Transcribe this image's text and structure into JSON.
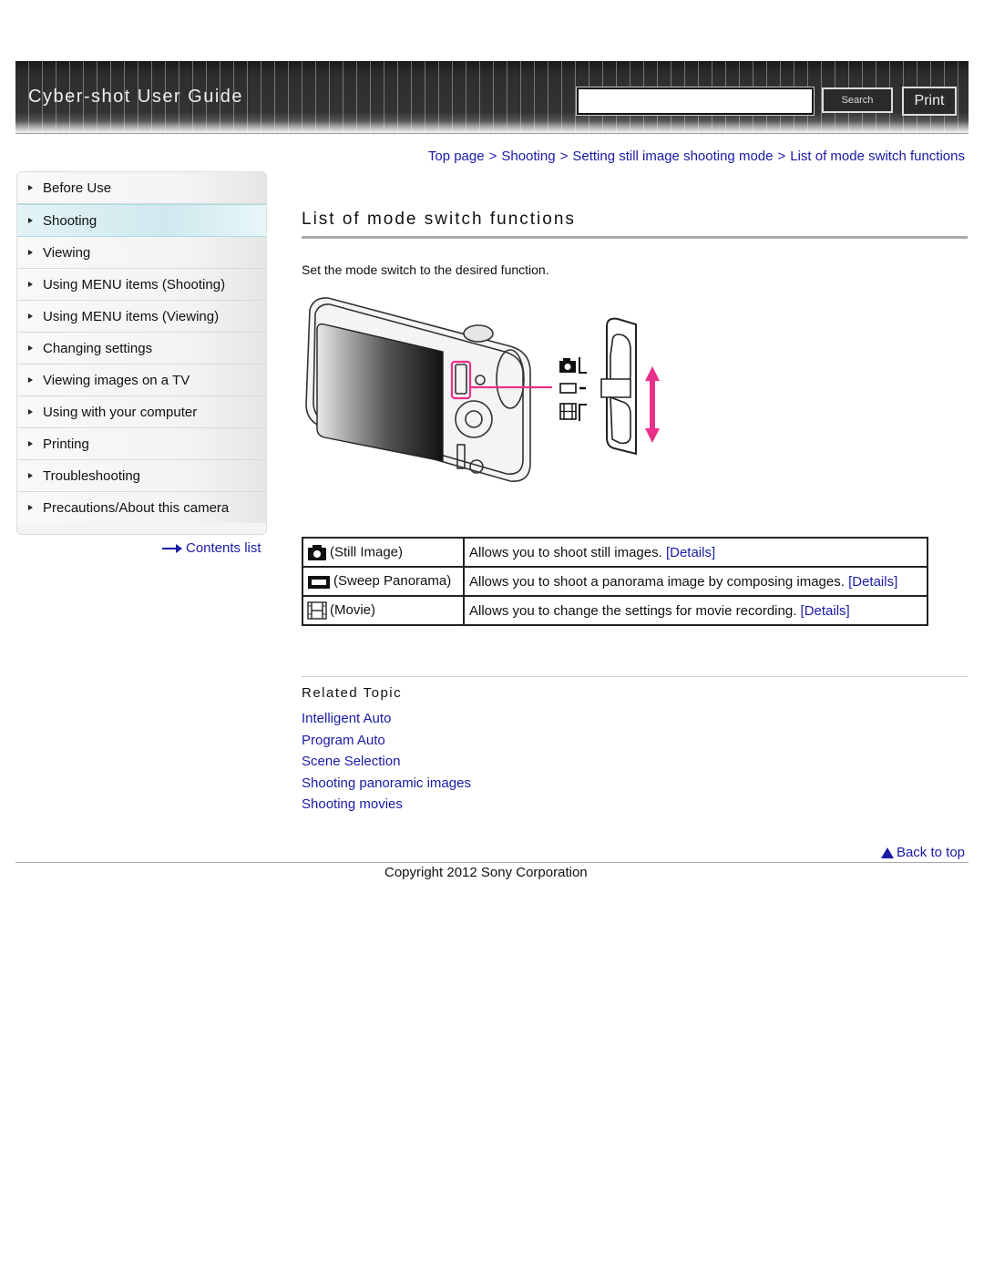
{
  "header": {
    "title": "Cyber-shot User Guide",
    "search_value": "",
    "search_button": "Search",
    "print_button": "Print"
  },
  "breadcrumb": [
    {
      "label": "Top page"
    },
    {
      "label": "Shooting"
    },
    {
      "label": "Setting still image shooting mode"
    },
    {
      "label": "List of mode switch functions"
    }
  ],
  "breadcrumb_separator": ">",
  "sidebar": {
    "items": [
      {
        "label": "Before Use",
        "active": false
      },
      {
        "label": "Shooting",
        "active": true
      },
      {
        "label": "Viewing",
        "active": false
      },
      {
        "label": "Using MENU items (Shooting)",
        "active": false
      },
      {
        "label": "Using MENU items (Viewing)",
        "active": false
      },
      {
        "label": "Changing settings",
        "active": false
      },
      {
        "label": "Viewing images on a TV",
        "active": false
      },
      {
        "label": "Using with your computer",
        "active": false
      },
      {
        "label": "Printing",
        "active": false
      },
      {
        "label": "Troubleshooting",
        "active": false
      },
      {
        "label": "Precautions/About this camera",
        "active": false
      }
    ],
    "contents_link": "Contents list"
  },
  "main": {
    "title": "List of mode switch functions",
    "intro": "Set the mode switch to the desired function.",
    "illustration_icons": [
      "still-image-icon",
      "sweep-panorama-icon",
      "movie-icon"
    ],
    "accent_color": "#e8308a",
    "modes": [
      {
        "icon": "still-image-icon",
        "name": "(Still Image)",
        "description": "Allows you to shoot still images.",
        "link": "[Details]"
      },
      {
        "icon": "sweep-panorama-icon",
        "name": "(Sweep Panorama)",
        "description": "Allows you to shoot a panorama image by composing images.",
        "link": "[Details]"
      },
      {
        "icon": "movie-icon",
        "name": "(Movie)",
        "description": "Allows you to change the settings for movie recording.",
        "link": "[Details]"
      }
    ]
  },
  "related": {
    "title": "Related Topic",
    "links": [
      "Intelligent Auto",
      "Program Auto",
      "Scene Selection",
      "Shooting panoramic images",
      "Shooting movies"
    ]
  },
  "footer": {
    "back_to_top": "Back to top",
    "copyright": "Copyright 2012 Sony Corporation"
  }
}
